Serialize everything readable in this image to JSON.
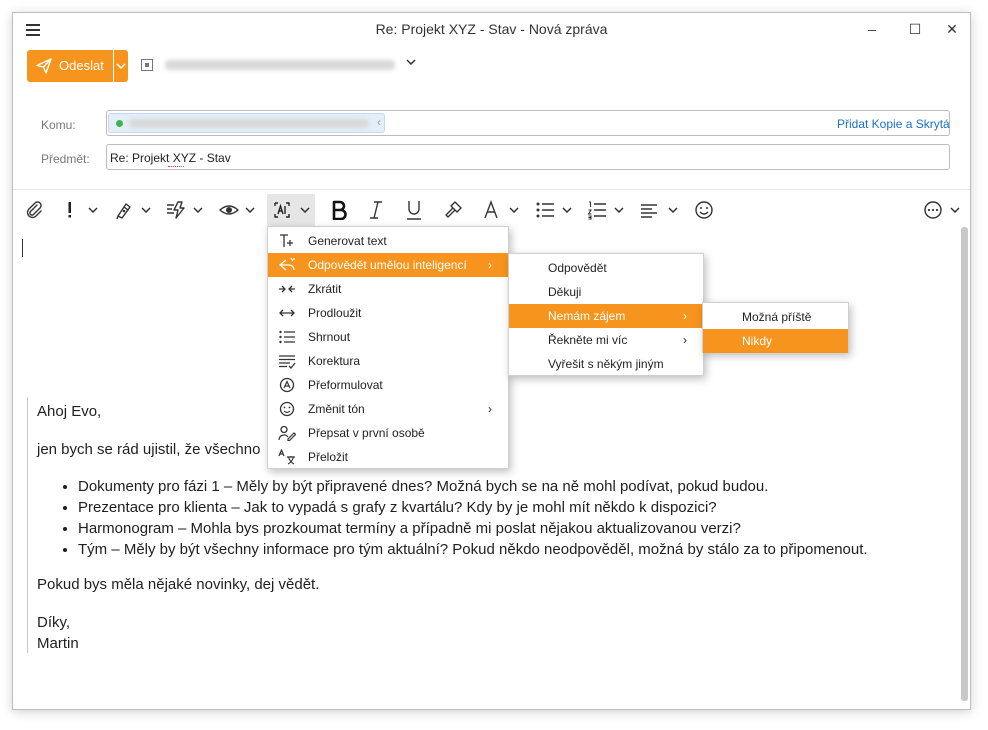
{
  "window": {
    "title": "Re: Projekt XYZ - Stav - Nová zpráva",
    "minimize_glyph": "–",
    "maximize_glyph": "☐",
    "close_glyph": "✕"
  },
  "compose": {
    "send_label": "Odeslat",
    "to_label": "Komu:",
    "subject_label": "Předmět:",
    "subject_value": "Re: Projekt XYZ - Stav",
    "add_cc_bcc_link": "Přidat Kopie a Skrytá"
  },
  "toolbar": {
    "icons": [
      "paperclip-icon",
      "importance-icon",
      "signature-icon",
      "quick-text-icon",
      "preview-eye-icon",
      "ai-assistant-icon",
      "bold-icon",
      "italic-icon",
      "underline-icon",
      "format-painter-icon",
      "font-color-icon",
      "bulleted-list-icon",
      "numbered-list-icon",
      "align-icon",
      "emoji-icon",
      "more-options-icon"
    ]
  },
  "ai_menu": {
    "items": [
      {
        "label": "Generovat text",
        "icon": "generate-text-icon"
      },
      {
        "label": "Odpovědět umělou inteligencí",
        "icon": "ai-reply-icon",
        "submenu": true
      },
      {
        "label": "Zkrátit",
        "icon": "shorten-icon"
      },
      {
        "label": "Prodloužit",
        "icon": "lengthen-icon"
      },
      {
        "label": "Shrnout",
        "icon": "summarize-icon"
      },
      {
        "label": "Korektura",
        "icon": "proofread-icon"
      },
      {
        "label": "Přeformulovat",
        "icon": "rephrase-icon"
      },
      {
        "label": "Změnit tón",
        "icon": "tone-icon",
        "submenu": true
      },
      {
        "label": "Přepsat v první osobě",
        "icon": "first-person-icon"
      },
      {
        "label": "Přeložit",
        "icon": "translate-icon"
      }
    ],
    "submenu_glyph": "›"
  },
  "reply_submenu": {
    "items": [
      {
        "label": "Odpovědět"
      },
      {
        "label": "Děkuji"
      },
      {
        "label": "Nemám zájem",
        "submenu": true
      },
      {
        "label": "Řekněte mi víc",
        "submenu": true
      },
      {
        "label": "Vyřešit s někým jiným"
      }
    ]
  },
  "not_interested_submenu": {
    "items": [
      {
        "label": "Možná příště"
      },
      {
        "label": "Nikdy"
      }
    ]
  },
  "message": {
    "greeting": "Ahoj Evo,",
    "intro": "jen bych se rád ujistil, že všechno",
    "bullets": [
      "Dokumenty pro fázi 1 – Měly by být připravené dnes? Možná bych se na ně mohl podívat, pokud budou.",
      "Prezentace pro klienta – Jak to vypadá s grafy z kvartálu? Kdy by je mohl mít někdo k dispozici?",
      "Harmonogram – Mohla bys prozkoumat termíny a případně mi poslat nějakou aktualizovanou verzi?",
      "Tým – Měly by být všechny informace pro tým aktuální? Pokud někdo neodpověděl, možná by stálo za to připomenout."
    ],
    "closing_line": "Pokud bys měla nějaké novinky, dej vědět.",
    "signoff": "Díky,",
    "signature": "Martin"
  },
  "colors": {
    "accent": "#f7941d",
    "link": "#1c6fc6",
    "chip_bg": "#e3eef9",
    "presence_green": "#3fb54b"
  }
}
